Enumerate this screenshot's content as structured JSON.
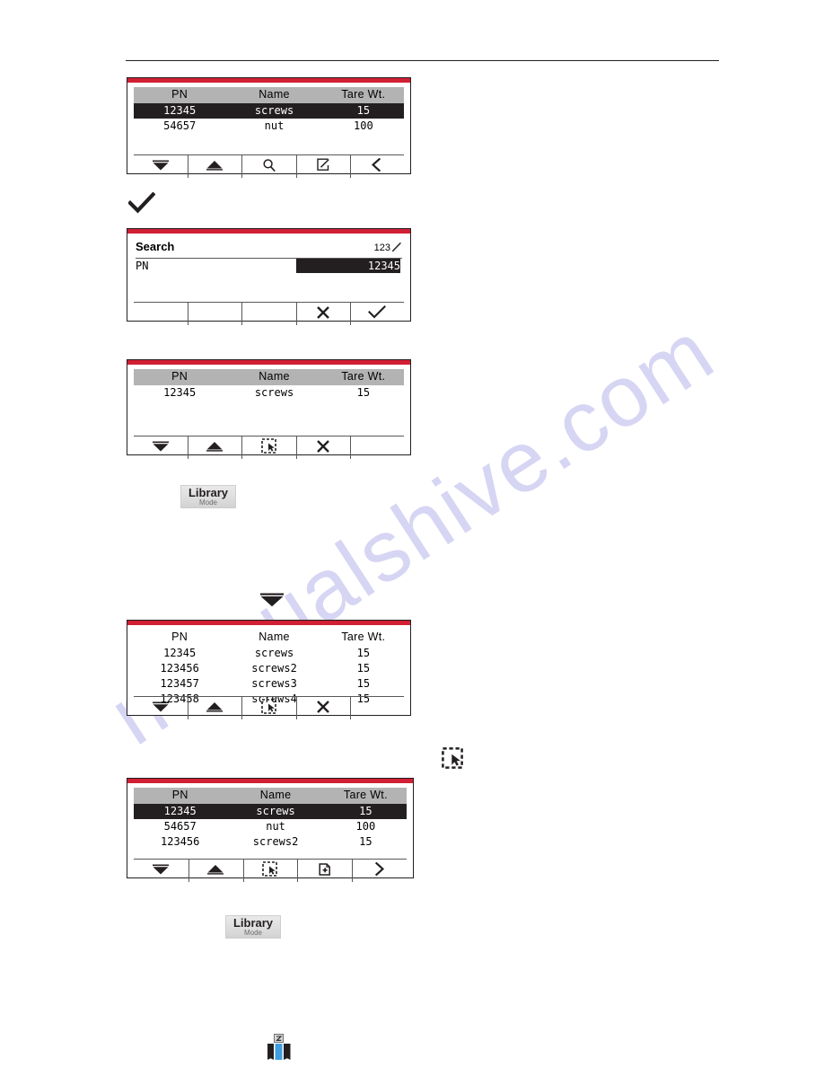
{
  "page": {
    "watermark": "manualshive.com",
    "columns": {
      "pn": "PN",
      "name": "Name",
      "tare": "Tare Wt."
    }
  },
  "panel1": {
    "name": "library-list-two-items",
    "headers": [
      "PN",
      "Name",
      "Tare Wt."
    ],
    "rows": [
      {
        "pn": "12345",
        "name": "screws",
        "tare": "15",
        "selected": true
      },
      {
        "pn": "54657",
        "name": "nut",
        "tare": "100",
        "selected": false
      }
    ],
    "softkeys": [
      {
        "icon": "down-arrow-icon",
        "label": "Down"
      },
      {
        "icon": "up-arrow-icon",
        "label": "Up"
      },
      {
        "icon": "search-icon",
        "label": "Search"
      },
      {
        "icon": "edit-icon",
        "label": "Edit"
      },
      {
        "icon": "back-chevron-icon",
        "label": "Back"
      }
    ]
  },
  "step1_glyph": {
    "icon": "check-icon",
    "label": "Confirm"
  },
  "panel2": {
    "name": "search-screen",
    "title": "Search",
    "input_mode": "123",
    "input_mode_icon": "pencil-icon",
    "field_label": "PN",
    "field_value": "12345",
    "field_placeholder": "PN",
    "softkeys": [
      {
        "icon": "",
        "label": ""
      },
      {
        "icon": "",
        "label": ""
      },
      {
        "icon": "",
        "label": ""
      },
      {
        "icon": "cancel-x-icon",
        "label": "Cancel"
      },
      {
        "icon": "check-icon",
        "label": "Accept"
      }
    ]
  },
  "panel3": {
    "name": "library-search-result",
    "headers": [
      "PN",
      "Name",
      "Tare Wt."
    ],
    "rows": [
      {
        "pn": "12345",
        "name": "screws",
        "tare": "15",
        "selected": false
      }
    ],
    "softkeys": [
      {
        "icon": "down-arrow-icon",
        "label": "Down"
      },
      {
        "icon": "up-arrow-icon",
        "label": "Up"
      },
      {
        "icon": "select-item-icon",
        "label": "Select"
      },
      {
        "icon": "cancel-x-icon",
        "label": "Cancel"
      },
      {
        "icon": "",
        "label": ""
      }
    ]
  },
  "key1": {
    "main": "Library",
    "sub": "Mode"
  },
  "step2_glyph": {
    "icon": "down-arrow-icon",
    "label": "Scroll down"
  },
  "panel4": {
    "name": "library-list-four-items",
    "headers": [
      "PN",
      "Name",
      "Tare Wt."
    ],
    "rows": [
      {
        "pn": "12345",
        "name": "screws",
        "tare": "15",
        "selected": false
      },
      {
        "pn": "123456",
        "name": "screws2",
        "tare": "15",
        "selected": false
      },
      {
        "pn": "123457",
        "name": "screws3",
        "tare": "15",
        "selected": false
      },
      {
        "pn": "123458",
        "name": "screws4",
        "tare": "15",
        "selected": false
      }
    ],
    "softkeys": [
      {
        "icon": "down-arrow-icon",
        "label": "Down"
      },
      {
        "icon": "up-arrow-icon",
        "label": "Up"
      },
      {
        "icon": "select-item-icon",
        "label": "Select"
      },
      {
        "icon": "cancel-x-icon",
        "label": "Cancel"
      },
      {
        "icon": "",
        "label": ""
      }
    ]
  },
  "step3_glyph": {
    "icon": "select-item-icon",
    "label": "Select"
  },
  "panel5": {
    "name": "library-list-three-items",
    "headers": [
      "PN",
      "Name",
      "Tare Wt."
    ],
    "rows": [
      {
        "pn": "12345",
        "name": "screws",
        "tare": "15",
        "selected": true
      },
      {
        "pn": "54657",
        "name": "nut",
        "tare": "100",
        "selected": false
      },
      {
        "pn": "123456",
        "name": "screws2",
        "tare": "15",
        "selected": false
      }
    ],
    "softkeys": [
      {
        "icon": "down-arrow-icon",
        "label": "Down"
      },
      {
        "icon": "up-arrow-icon",
        "label": "Up"
      },
      {
        "icon": "select-item-icon",
        "label": "Select"
      },
      {
        "icon": "add-item-icon",
        "label": "Add"
      },
      {
        "icon": "forward-chevron-icon",
        "label": "Next"
      }
    ]
  },
  "key2": {
    "main": "Library",
    "sub": "Mode"
  },
  "step4_glyph": {
    "icon": "library-books-icon",
    "label": "Library",
    "accent": "#3f9fe0"
  }
}
